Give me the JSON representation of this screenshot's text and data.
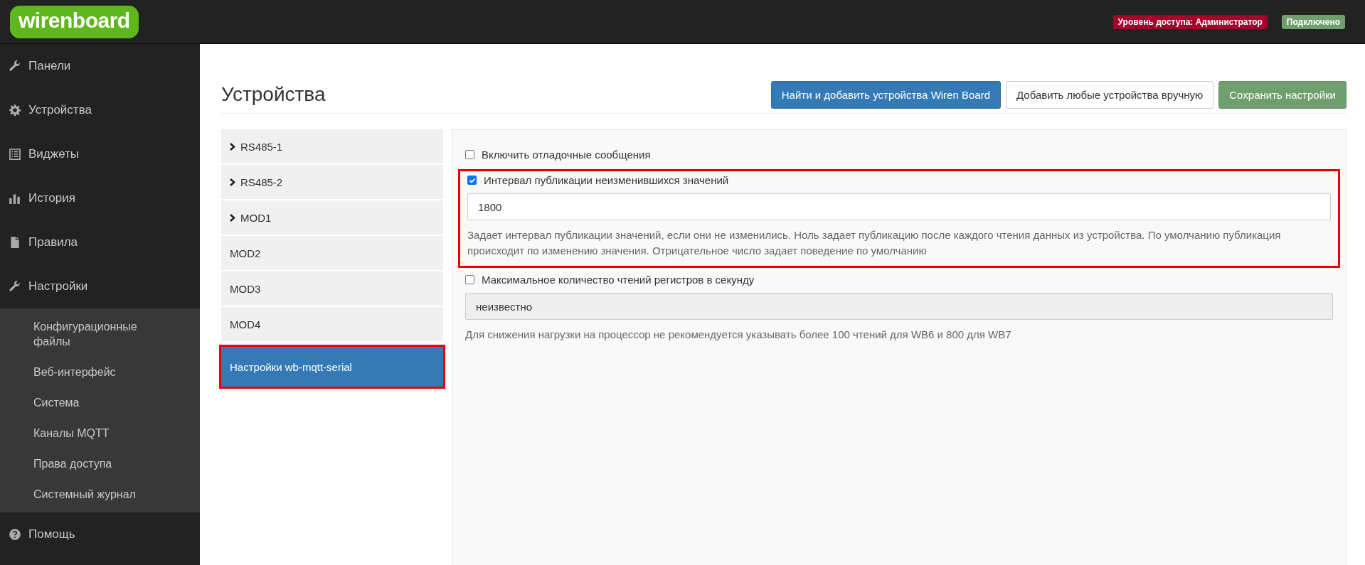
{
  "logo": {
    "text": "wirenboard"
  },
  "header": {
    "badges": [
      {
        "text": "Уровень доступа: Администратор",
        "color": "#a6002b"
      },
      {
        "text": "Подключено",
        "color": "#6f9e6f"
      }
    ]
  },
  "sidebar": {
    "items": [
      {
        "label": "Панели",
        "kind": "wrench"
      },
      {
        "label": "Устройства",
        "kind": "gear"
      },
      {
        "label": "Виджеты",
        "kind": "list"
      },
      {
        "label": "История",
        "kind": "chart"
      },
      {
        "label": "Правила",
        "kind": "file"
      },
      {
        "label": "Настройки",
        "kind": "wrench",
        "children": [
          {
            "label": "Конфигурационные файлы"
          },
          {
            "label": "Веб-интерфейс"
          },
          {
            "label": "Система"
          },
          {
            "label": "Каналы MQTT"
          },
          {
            "label": "Права доступа"
          },
          {
            "label": "Системный журнал"
          }
        ]
      },
      {
        "label": "Помощь",
        "kind": "help"
      }
    ]
  },
  "page": {
    "title": "Устройства",
    "buttons": [
      {
        "label": "Найти и добавить устройства Wiren Board",
        "kind": "primary"
      },
      {
        "label": "Добавить любые устройства вручную",
        "kind": "default"
      },
      {
        "label": "Сохранить настройки",
        "kind": "success"
      }
    ]
  },
  "devices": [
    {
      "label": "RS485-1",
      "collapsible": true,
      "selected": false,
      "highlighted": false
    },
    {
      "label": "RS485-2",
      "collapsible": true,
      "selected": false,
      "highlighted": false
    },
    {
      "label": "MOD1",
      "collapsible": true,
      "selected": false,
      "highlighted": false
    },
    {
      "label": "MOD2",
      "collapsible": false,
      "selected": false,
      "highlighted": false
    },
    {
      "label": "MOD3",
      "collapsible": false,
      "selected": false,
      "highlighted": false
    },
    {
      "label": "MOD4",
      "collapsible": false,
      "selected": false,
      "highlighted": false
    },
    {
      "label": "Настройки wb-mqtt-serial",
      "collapsible": false,
      "selected": true,
      "highlighted": true
    }
  ],
  "settings": [
    {
      "label": "Включить отладочные сообщения",
      "checked": false,
      "highlighted": false
    },
    {
      "label": "Интервал публикации неизменившихся значений",
      "checked": true,
      "highlighted": true,
      "value": "1800",
      "disabled": false,
      "help": "Задает интервал публикации значений, если они не изменились. Ноль задает публикацию после каждого чтения данных из устройства. По умолчанию публикация происходит по изменению значения. Отрицательное число задает поведение по умолчанию"
    },
    {
      "label": "Максимальное количество чтений регистров в секунду",
      "checked": false,
      "highlighted": false,
      "value": "неизвестно",
      "disabled": true,
      "help": "Для снижения нагрузки на процессор не рекомендуется указывать более 100 чтений для WB6 и 800 для WB7"
    }
  ]
}
